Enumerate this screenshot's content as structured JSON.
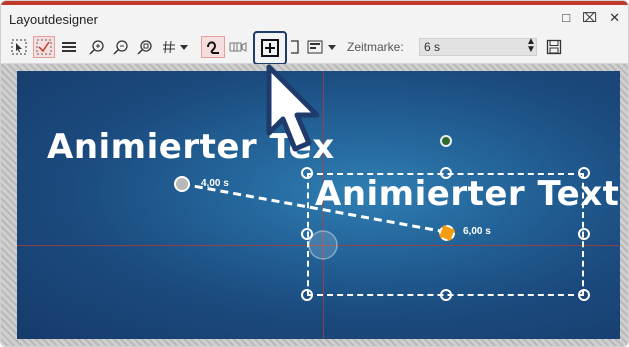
{
  "window": {
    "title": "Layoutdesigner"
  },
  "toolbar": {
    "time_label": "Zeitmarke:",
    "time_value": "6 s"
  },
  "canvas": {
    "text_back": "Animierter Tex",
    "text_front": "Animierter Text",
    "time_start": "4,00 s",
    "time_end": "6,00 s"
  },
  "colors": {
    "accent": "#c0392b",
    "stage_dark": "#163b6b",
    "stage_light": "#2f7fb3",
    "keyframe_active": "#f39c12",
    "rotate_handle": "#2e6b2e"
  },
  "icons": [
    "select-icon",
    "anchor-icon",
    "layers-icon",
    "zoom-in-icon",
    "zoom-out-icon",
    "zoom-fit-icon",
    "grid-icon",
    "curve-icon",
    "film-icon",
    "add-keyframe-icon",
    "crop-icon",
    "align-icon",
    "save-icon",
    "maximize-icon",
    "pin-icon",
    "close-icon"
  ]
}
